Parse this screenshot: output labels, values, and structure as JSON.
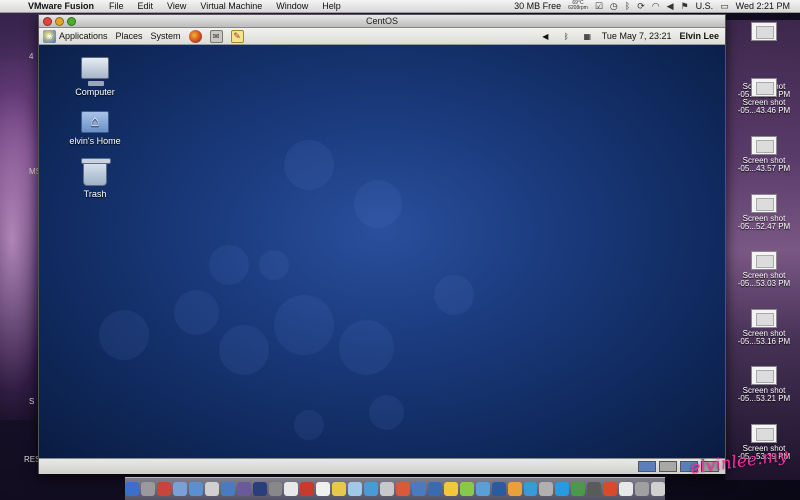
{
  "mac_menubar": {
    "app_name": "VMware Fusion",
    "menus": [
      "File",
      "Edit",
      "View",
      "Virtual Machine",
      "Window",
      "Help"
    ],
    "mem_free": "30 MB Free",
    "temp_top": "69°C",
    "temp_bottom": "6208rpm",
    "locale": "U.S.",
    "clock": "Wed 2:21 PM"
  },
  "mac_desktop_labels": [
    "4",
    "MS",
    "S",
    "RES"
  ],
  "vm_window": {
    "title": "CentOS"
  },
  "gnome_panel": {
    "menus": [
      "Applications",
      "Places",
      "System"
    ],
    "clock": "Tue May  7, 23:21",
    "user": "Elvin Lee"
  },
  "desktop_icons": [
    {
      "label": "Computer"
    },
    {
      "label": "elvin's Home"
    },
    {
      "label": "Trash"
    }
  ],
  "screenshots": [
    {
      "l1": "",
      "l2": ""
    },
    {
      "l1": "Screen shot",
      "l2": "-05...43.35 PM"
    },
    {
      "l1": "Screen shot",
      "l2": "-05...43.46 PM"
    },
    {
      "l1": "Screen shot",
      "l2": "-05...43.57 PM"
    },
    {
      "l1": "Screen shot",
      "l2": "-05...52.47 PM"
    },
    {
      "l1": "Screen shot",
      "l2": "-05...53.03 PM"
    },
    {
      "l1": "Screen shot",
      "l2": "-05...53.16 PM"
    },
    {
      "l1": "Screen shot",
      "l2": "-05...53.21 PM"
    },
    {
      "l1": "Screen shot",
      "l2": "-05...53.39 PM"
    }
  ],
  "watermark": "elvinlee.my",
  "colors": {
    "centos_bg": "#1b3b7e",
    "workspace_active": "#5b7fba",
    "watermark": "#ff2aa0"
  }
}
